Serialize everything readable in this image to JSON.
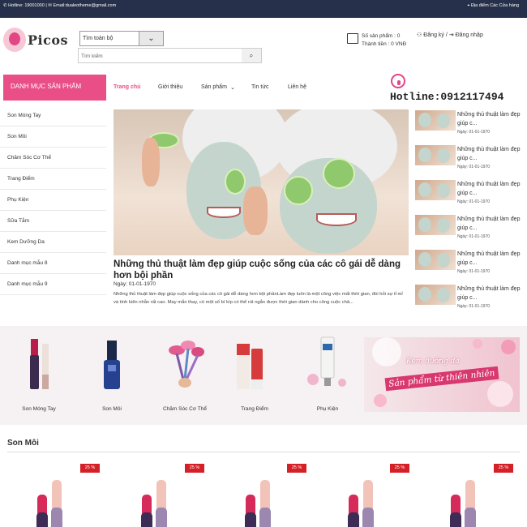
{
  "topbar": {
    "hotline": "Hotline: 19001000",
    "email": "Email:dualeotheme@gmail.com",
    "store_locator": "Địa điểm Các Cửa hàng"
  },
  "logo": {
    "text": "Picos"
  },
  "search": {
    "category_label": "Tìm toàn bộ",
    "placeholder": "Tìm kiếm"
  },
  "cart": {
    "count_label": "Số sản phẩm : 0",
    "total_label": "Thành tiền : 0 VNĐ"
  },
  "auth": {
    "register": "Đăng ký",
    "separator": " / ",
    "login": "Đăng nhập"
  },
  "nav": {
    "category_button": "DANH MỤC SẢN PHẨM",
    "links": [
      "Trang chủ",
      "Giới thiệu",
      "Sản phẩm",
      "Tin tức",
      "Liên hệ"
    ],
    "hotline": "Hotline:0912117494"
  },
  "sidebar": {
    "items": [
      "Son Móng Tay",
      "Son Môi",
      "Chăm Sóc Cơ Thể",
      "Trang Điểm",
      "Phụ Kiện",
      "Sữa Tắm",
      "Kem Dưỡng Da",
      "Danh mục mẫu 8",
      "Danh mục mẫu 9"
    ]
  },
  "article": {
    "title": "Những thủ thuật làm đẹp giúp cuộc sống của các cô gái dễ dàng hơn bội phần",
    "date": "Ngày: 01-01-1970",
    "excerpt": "Những thủ thuật làm đẹp giúp cuộc sống của các cô gái dễ dàng hơn bội phầnLàm đẹp luôn là một công việc mất thời gian, đòi hỏi sự tỉ mỉ và tính kiên nhẫn rất cao. May mắn thay, có một số bí kíp có thể rút ngắn được thời gian dành cho công cuộc chă..."
  },
  "side_news": [
    {
      "title": "Những thủ thuật làm đẹp giúp c...",
      "date": "Ngày: 01-01-1970"
    },
    {
      "title": "Những thủ thuật làm đẹp giúp c...",
      "date": "Ngày: 01-01-1970"
    },
    {
      "title": "Những thủ thuật làm đẹp giúp c...",
      "date": "Ngày: 01-01-1970"
    },
    {
      "title": "Những thủ thuật làm đẹp giúp c...",
      "date": "Ngày: 01-01-1970"
    },
    {
      "title": "Những thủ thuật làm đẹp giúp c...",
      "date": "Ngày: 01-01-1970"
    },
    {
      "title": "Những thủ thuật làm đẹp giúp c...",
      "date": "Ngày: 01-01-1970"
    }
  ],
  "category_cards": [
    "Son Móng Tay",
    "Son Môi",
    "Chăm Sóc Cơ Thể",
    "Trang Điểm",
    "Phụ Kiện"
  ],
  "banner": {
    "line1": "Kem dưỡng da",
    "line2": "Sản phẩm từ thiên nhiên"
  },
  "section": {
    "title": "Son Môi",
    "products": [
      {
        "discount": "25 %"
      },
      {
        "discount": "25 %"
      },
      {
        "discount": "25 %"
      },
      {
        "discount": "25 %"
      },
      {
        "discount": "25 %"
      }
    ]
  },
  "colors": {
    "accent": "#ea4e86",
    "topbar": "#27304a",
    "sale": "#d42027"
  }
}
